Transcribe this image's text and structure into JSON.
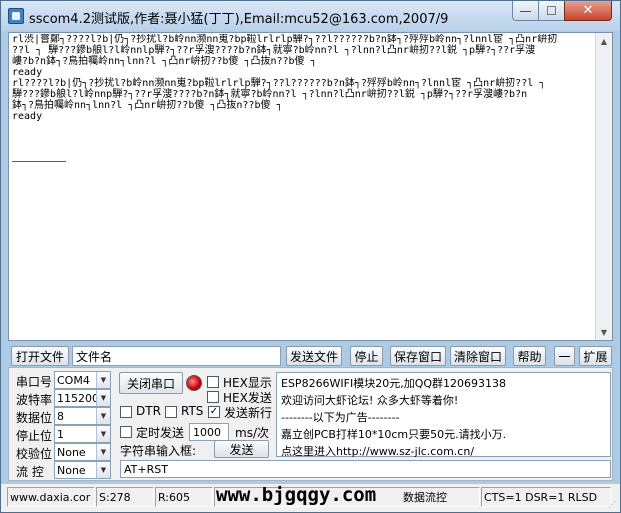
{
  "window": {
    "title": "sscom4.2测试版,作者:聂小猛(丁丁),Email:mcu52@163.com,2007/9",
    "close_glyph": "✕",
    "max_glyph": "☐",
    "min_glyph": "—"
  },
  "receive": {
    "lines": [
      "rl渋|嘗鄭┐????l?b|仍┐?抄扰l?b岭nn濒nn嵬?bp鞡lrlrlp騨?┐??l??????b?n鉢┐?殍殍b岭nn┐?lnnl宦 ┐凸nr峅扨",
      "??l ┐ 騨???鏒b艆l?l岭nnlp騨?┐??r孚溲????b?n鉢┐就寧?b岭nn?l ┐?lnn?l凸nr峅扨??l鋭 ┐p騨?┐??r孚溲",
      "嶁?b?n鉢┐?鳥拍囑岭nn┐lnn?l ┐凸nr峅扨??b傻 ┐凸抜n??b傻 ┐",
      "ready",
      "rl????l?b|仍┐?抄扰l?b岭nn濒nn嵬?bp鞡lrlrlp騨?┐??l??????b?n鉢┐?殍殍b岭nn┐?lnnl宦 ┐凸nr峅扨??l ┐",
      "騨???鏒b艆l?l岭nnp騨?┐??r孚溲????b?n鉢┐就寧?b岭nn?l ┐?lnn?l凸nr峅扨??l鋭 ┐p騨?┐??r孚溲嶁?b?n",
      "鉢┐?鳥拍囑岭nn┐lnn?l ┐凸nr峅扨??b傻 ┐凸抜n??b傻 ┐",
      "ready"
    ],
    "scroll_up": "▲",
    "scroll_down": "▼"
  },
  "toolbar": {
    "open_file": "打开文件",
    "file_name_placeholder": "文件名",
    "send_file": "发送文件",
    "stop": "停止",
    "save_window": "保存窗口",
    "clear_window": "清除窗口",
    "help": "帮助",
    "collapse": "一",
    "expand": "扩展"
  },
  "settings": {
    "port_label": "串口号",
    "port_value": "COM4",
    "baud_label": "波特率",
    "baud_value": "115200",
    "databits_label": "数据位",
    "databits_value": "8",
    "stopbits_label": "停止位",
    "stopbits_value": "1",
    "parity_label": "校验位",
    "parity_value": "None",
    "flow_label": "流 控",
    "flow_value": "None",
    "close_port": "关闭串口",
    "hex_display": "HEX显示",
    "hex_send": "HEX发送",
    "send_newline": "发送新行",
    "dtr": "DTR",
    "rts": "RTS",
    "timed_send": "定时发送",
    "interval_value": "1000",
    "interval_unit": "ms/次",
    "input_label": "字符串输入框:",
    "send_button": "发送",
    "send_input": "AT+RST",
    "check_glyph": "✓",
    "arrow_glyph": "▼"
  },
  "info": {
    "lines": [
      "ESP8266WIFI模块20元,加QQ群120693138",
      "欢迎访问大虾论坛! 众多大虾等着你!",
      "--------以下为广告--------",
      "嘉立创PCB打样10*10cm只要50元.请找小万.",
      "点这里进入http://www.sz-jlc.com.cn/"
    ]
  },
  "status": {
    "site": "www.daxia.cor",
    "sent": "S:278",
    "received": "R:605",
    "banner": "www.bjgqgy.com",
    "port_status": "数据流控",
    "line_status": "CTS=1 DSR=1 RLSD"
  }
}
